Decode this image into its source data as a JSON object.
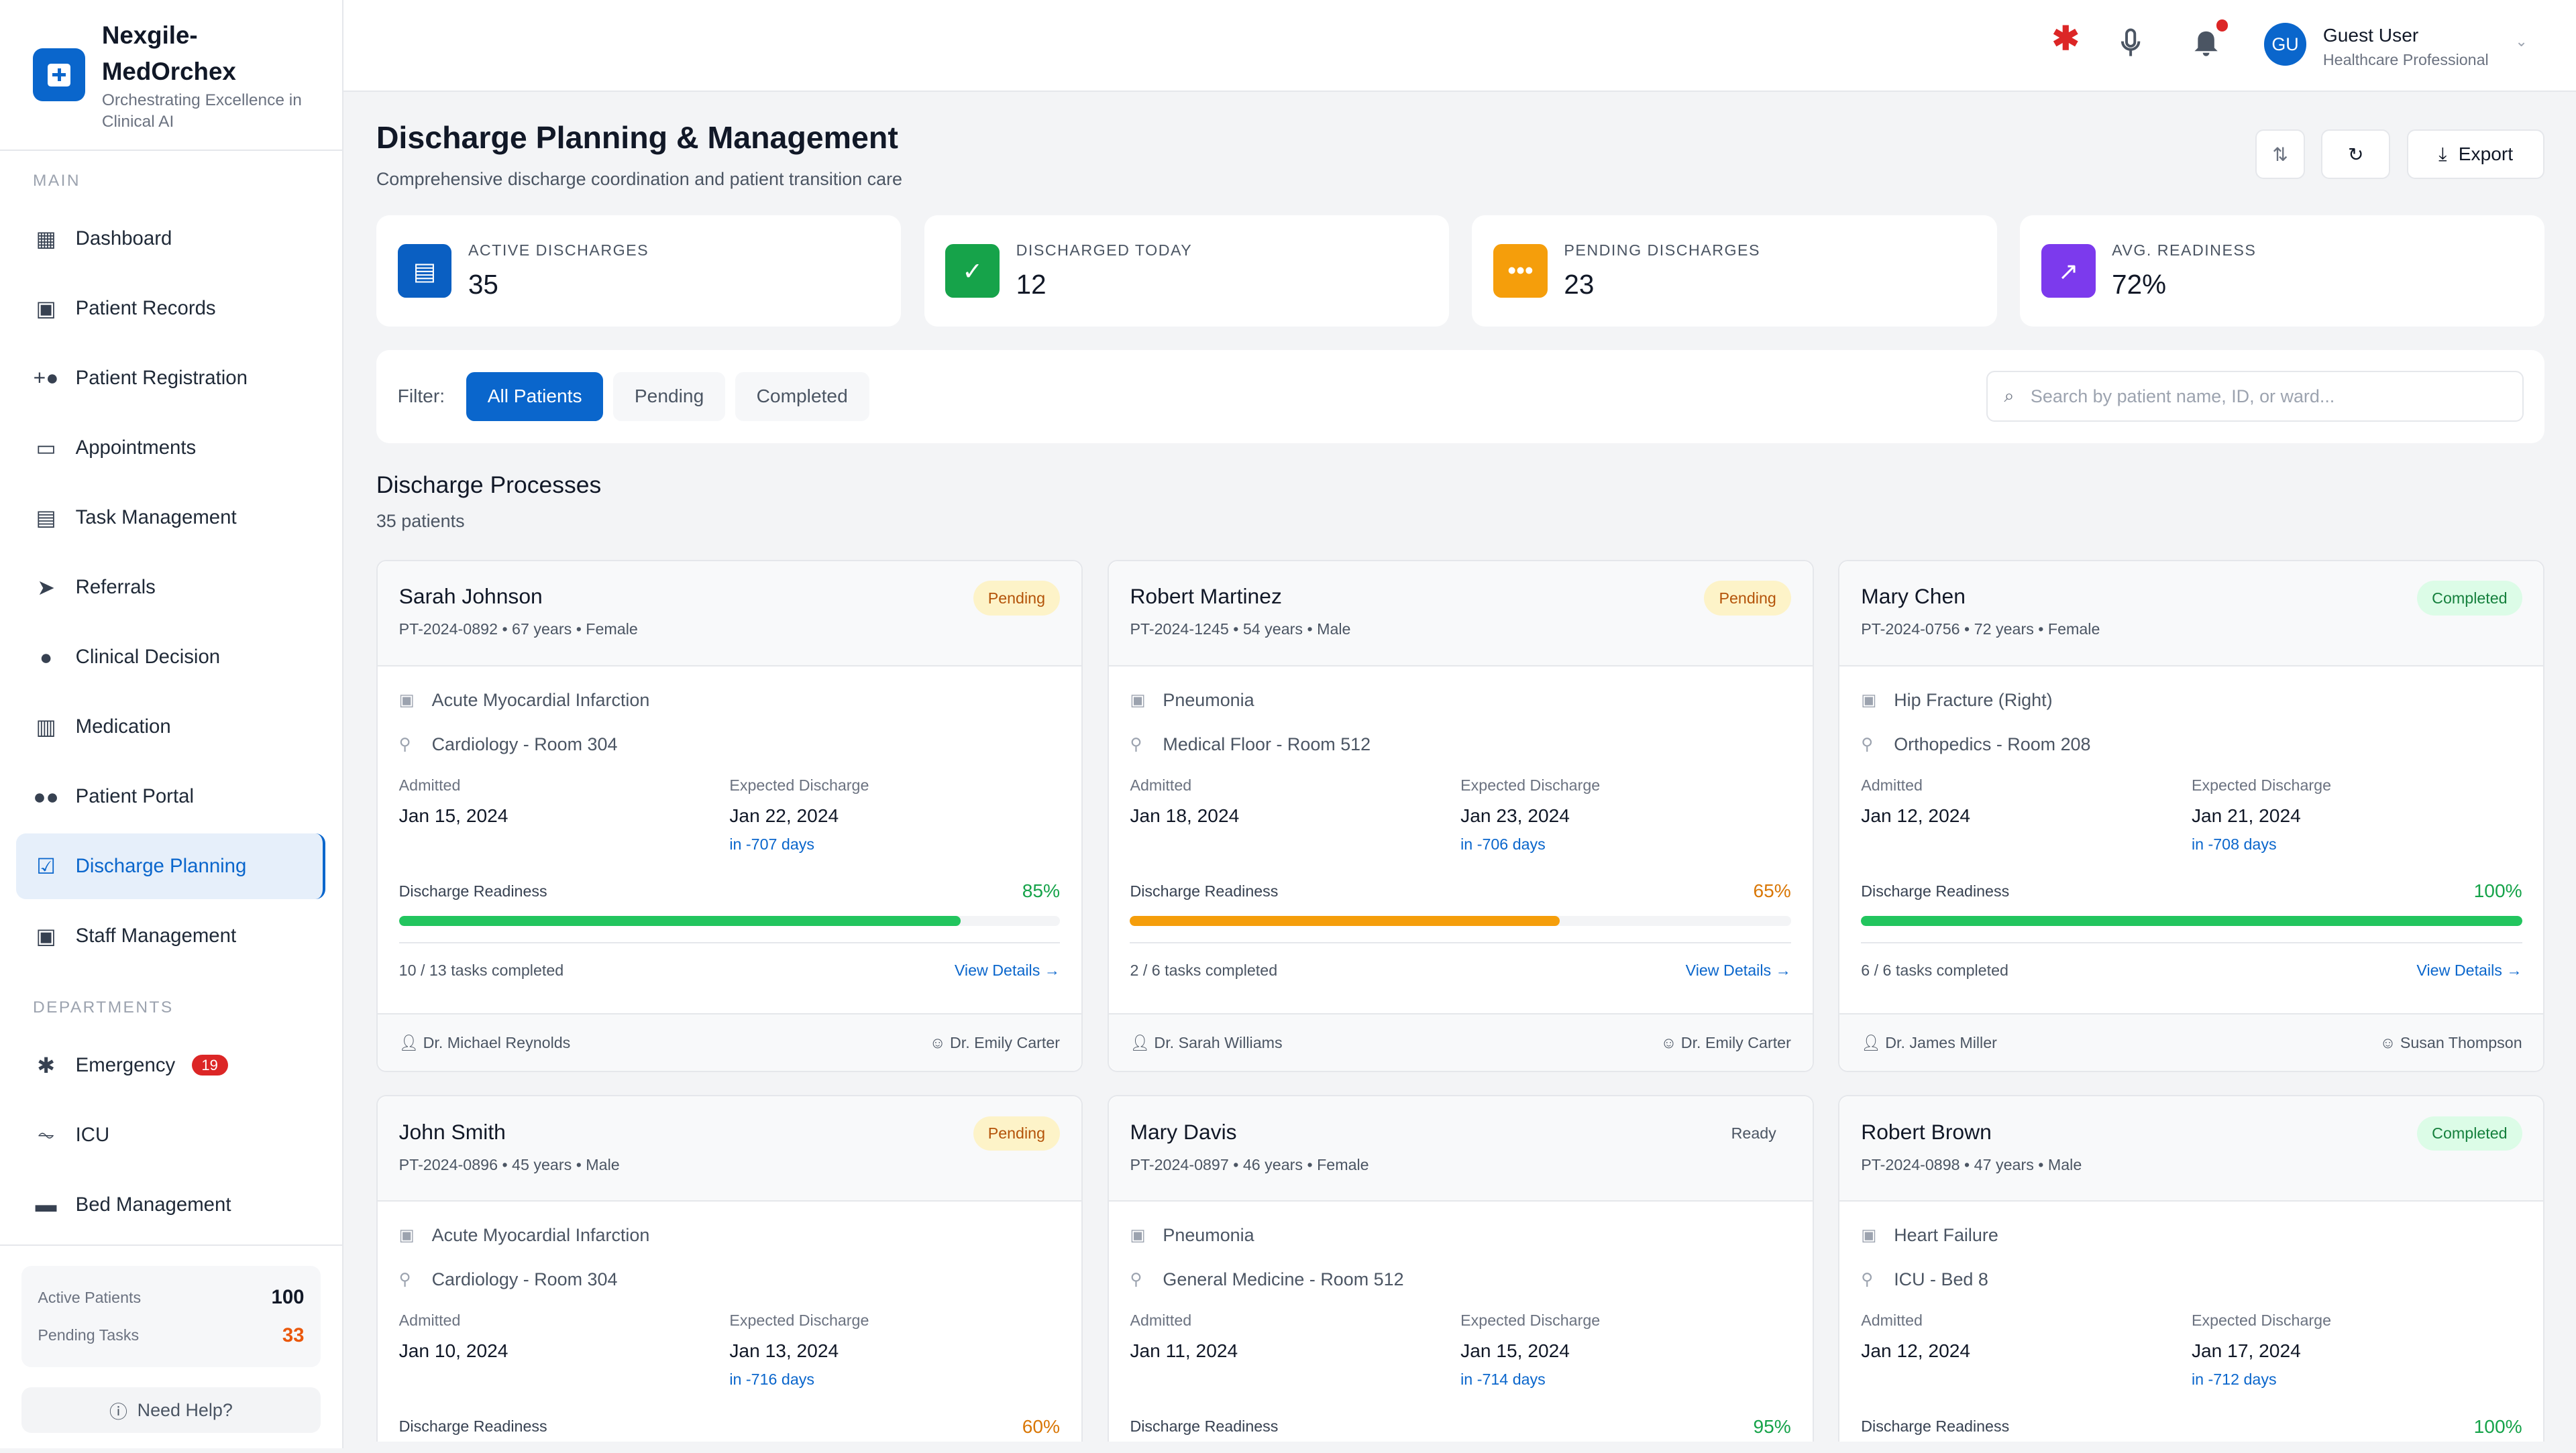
{
  "brand": {
    "name_line1": "Nexgile-",
    "name_line2": "MedOrchex",
    "tagline": "Orchestrating Excellence in Clinical AI"
  },
  "sidebar": {
    "main_label": "MAIN",
    "items": [
      {
        "label": "Dashboard",
        "icon": "dashboard-icon"
      },
      {
        "label": "Patient Records",
        "icon": "patient-records-icon"
      },
      {
        "label": "Patient Registration",
        "icon": "add-person-icon"
      },
      {
        "label": "Appointments",
        "icon": "calendar-icon"
      },
      {
        "label": "Task Management",
        "icon": "clipboard-icon"
      },
      {
        "label": "Referrals",
        "icon": "send-icon"
      },
      {
        "label": "Clinical Decision",
        "icon": "lightbulb-icon"
      },
      {
        "label": "Medication",
        "icon": "medication-icon"
      },
      {
        "label": "Patient Portal",
        "icon": "people-icon"
      },
      {
        "label": "Discharge Planning",
        "icon": "clipboard-check-icon",
        "active": true
      },
      {
        "label": "Staff Management",
        "icon": "badge-icon"
      }
    ],
    "departments_label": "DEPARTMENTS",
    "departments": [
      {
        "label": "Emergency",
        "icon": "asterisk-icon",
        "badge": "19"
      },
      {
        "label": "ICU",
        "icon": "monitor-heart-icon"
      },
      {
        "label": "Bed Management",
        "icon": "bed-icon"
      }
    ],
    "stats": {
      "active_label": "Active Patients",
      "active_value": "100",
      "pending_label": "Pending Tasks",
      "pending_value": "33"
    },
    "help": "Need Help?"
  },
  "topbar": {
    "user_initials": "GU",
    "user_name": "Guest User",
    "user_role": "Healthcare Professional",
    "notification_dot": true
  },
  "page": {
    "title": "Discharge Planning & Management",
    "subtitle": "Comprehensive discharge coordination and patient transition care",
    "export": "Export"
  },
  "kpis": [
    {
      "label": "ACTIVE DISCHARGES",
      "value": "35",
      "color": "#0a5fc2",
      "icon": "clipboard-icon"
    },
    {
      "label": "DISCHARGED TODAY",
      "value": "12",
      "color": "#16a34a",
      "icon": "check-circle-icon"
    },
    {
      "label": "PENDING DISCHARGES",
      "value": "23",
      "color": "#f59e0b",
      "icon": "pending-icon"
    },
    {
      "label": "AVG. READINESS",
      "value": "72%",
      "color": "#7c3aed",
      "icon": "trending-up-icon"
    }
  ],
  "filter": {
    "label": "Filter:",
    "options": [
      "All Patients",
      "Pending",
      "Completed"
    ],
    "selected": "All Patients",
    "search_placeholder": "Search by patient name, ID, or ward..."
  },
  "list": {
    "title": "Discharge Processes",
    "count": "35 patients"
  },
  "labels": {
    "admitted": "Admitted",
    "expected": "Expected Discharge",
    "readiness": "Discharge Readiness",
    "view": "View Details →"
  },
  "patients": [
    {
      "name": "Sarah Johnson",
      "meta": "PT-2024-0892 • 67 years • Female",
      "status": "Pending",
      "diagnosis": "Acute Myocardial Infarction",
      "location": "Cardiology - Room 304",
      "admitted": "Jan 15, 2024",
      "expected": "Jan 22, 2024",
      "due": "in -707 days",
      "readiness": 85,
      "readiness_text": "85%",
      "color": "#22c55e",
      "tasks": "10 / 13 tasks completed",
      "physician": "Dr. Michael Reynolds",
      "coordinator": "Dr. Emily Carter"
    },
    {
      "name": "Robert Martinez",
      "meta": "PT-2024-1245 • 54 years • Male",
      "status": "Pending",
      "diagnosis": "Pneumonia",
      "location": "Medical Floor - Room 512",
      "admitted": "Jan 18, 2024",
      "expected": "Jan 23, 2024",
      "due": "in -706 days",
      "readiness": 65,
      "readiness_text": "65%",
      "color": "#f59e0b",
      "tasks": "2 / 6 tasks completed",
      "physician": "Dr. Sarah Williams",
      "coordinator": "Dr. Emily Carter"
    },
    {
      "name": "Mary Chen",
      "meta": "PT-2024-0756 • 72 years • Female",
      "status": "Completed",
      "diagnosis": "Hip Fracture (Right)",
      "location": "Orthopedics - Room 208",
      "admitted": "Jan 12, 2024",
      "expected": "Jan 21, 2024",
      "due": "in -708 days",
      "readiness": 100,
      "readiness_text": "100%",
      "color": "#22c55e",
      "tasks": "6 / 6 tasks completed",
      "physician": "Dr. James Miller",
      "coordinator": "Susan Thompson"
    },
    {
      "name": "John Smith",
      "meta": "PT-2024-0896 • 45 years • Male",
      "status": "Pending",
      "diagnosis": "Acute Myocardial Infarction",
      "location": "Cardiology - Room 304",
      "admitted": "Jan 10, 2024",
      "expected": "Jan 13, 2024",
      "due": "in -716 days",
      "readiness": 60,
      "readiness_text": "60%",
      "color": "#f59e0b"
    },
    {
      "name": "Mary Davis",
      "meta": "PT-2024-0897 • 46 years • Female",
      "status": "Ready",
      "diagnosis": "Pneumonia",
      "location": "General Medicine - Room 512",
      "admitted": "Jan 11, 2024",
      "expected": "Jan 15, 2024",
      "due": "in -714 days",
      "readiness": 95,
      "readiness_text": "95%",
      "color": "#22c55e"
    },
    {
      "name": "Robert Brown",
      "meta": "PT-2024-0898 • 47 years • Male",
      "status": "Completed",
      "diagnosis": "Heart Failure",
      "location": "ICU - Bed 8",
      "admitted": "Jan 12, 2024",
      "expected": "Jan 17, 2024",
      "due": "in -712 days",
      "readiness": 100,
      "readiness_text": "100%",
      "color": "#22c55e"
    }
  ]
}
